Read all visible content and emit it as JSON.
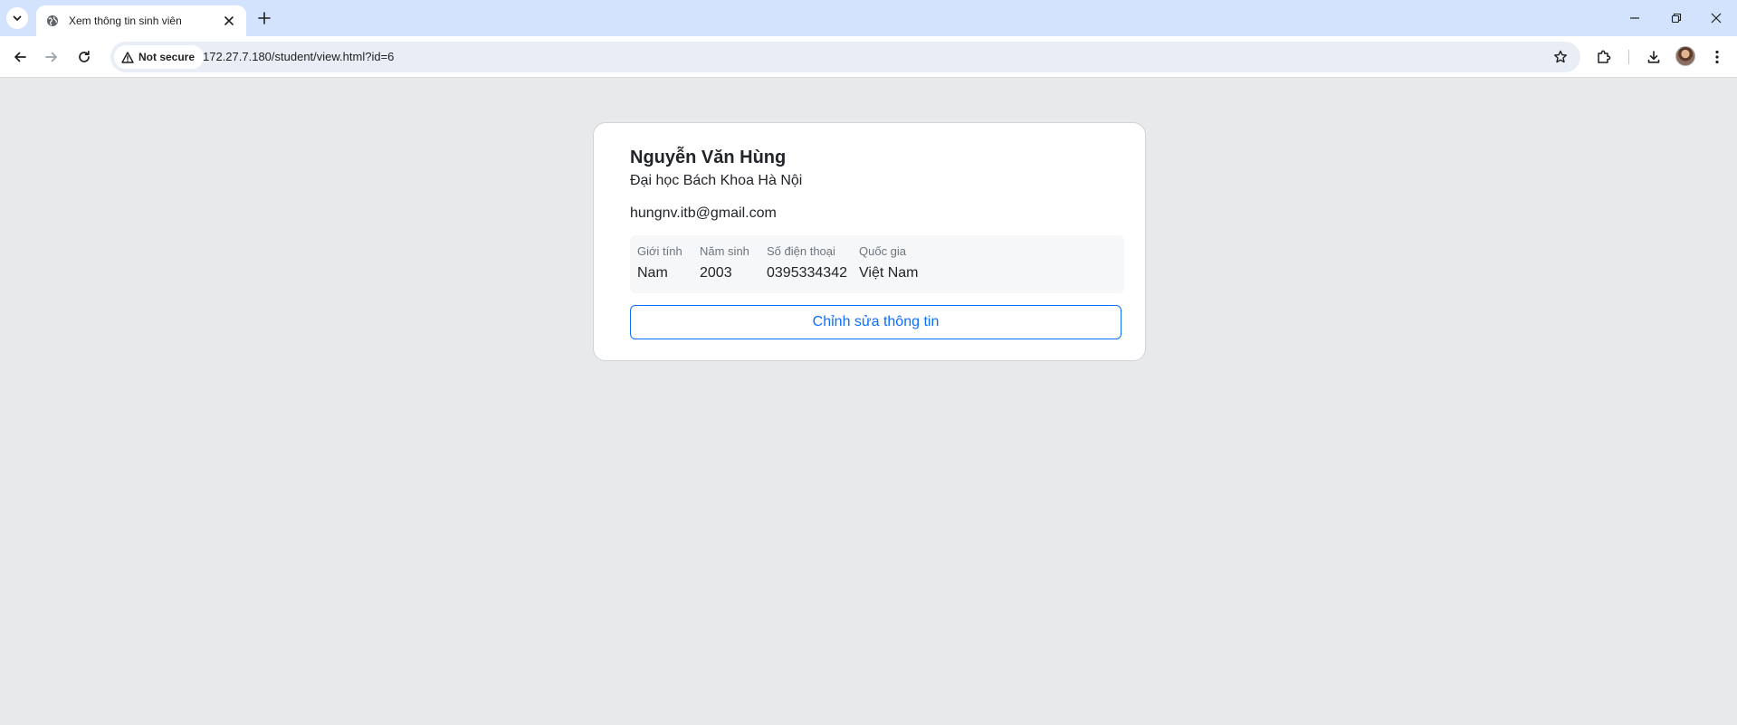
{
  "browser": {
    "tab": {
      "title": "Xem thông tin sinh viên"
    },
    "security": {
      "label": "Not secure"
    },
    "url": "172.27.7.180/student/view.html?id=6"
  },
  "student": {
    "name": "Nguyễn Văn Hùng",
    "school": "Đại học Bách Khoa Hà Nội",
    "email": "hungnv.itb@gmail.com",
    "fields": [
      {
        "label": "Giới tính",
        "value": "Nam"
      },
      {
        "label": "Năm sinh",
        "value": "2003"
      },
      {
        "label": "Số điện thoại",
        "value": "0395334342"
      },
      {
        "label": "Quốc gia",
        "value": "Việt Nam"
      }
    ],
    "edit_label": "Chỉnh sửa thông tin"
  },
  "colors": {
    "accent": "#0d6efd",
    "tabstrip": "#d3e3fd",
    "page_bg": "#e8e9eb"
  },
  "icons": [
    "tab-search-icon",
    "globe-icon",
    "close-icon",
    "plus-icon",
    "minimize-icon",
    "restore-icon",
    "window-close-icon",
    "back-arrow-icon",
    "forward-arrow-icon",
    "reload-icon",
    "warning-icon",
    "star-icon",
    "extensions-icon",
    "download-icon",
    "avatar",
    "more-vert-icon"
  ]
}
